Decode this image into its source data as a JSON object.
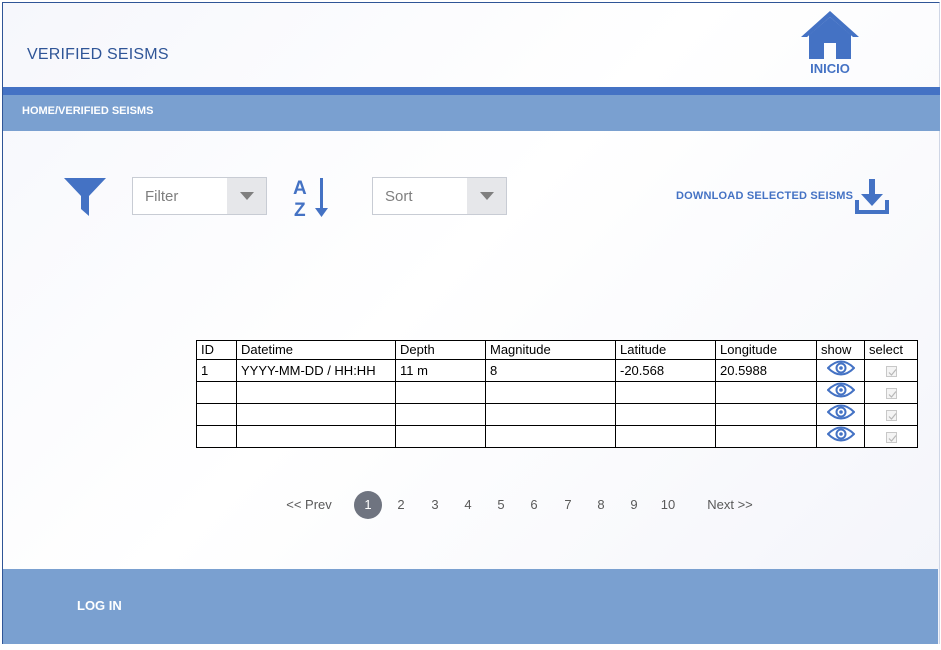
{
  "header": {
    "title": "VERIFIED SEISMS",
    "home_label": "INICIO"
  },
  "breadcrumb": "HOME/VERIFIED SEISMS",
  "toolbar": {
    "filter_value": "Filter",
    "sort_value": "Sort",
    "download_label": "DOWNLOAD SELECTED SEISMS"
  },
  "table": {
    "columns": [
      "ID",
      "Datetime",
      "Depth",
      "Magnitude",
      "Latitude",
      "Longitude",
      "show",
      "select"
    ],
    "rows": [
      [
        "1",
        "YYYY-MM-DD / HH:HH",
        "11 m",
        "8",
        "-20.568",
        "20.5988"
      ],
      [
        "",
        "",
        "",
        "",
        "",
        ""
      ],
      [
        "",
        "",
        "",
        "",
        "",
        ""
      ],
      [
        "",
        "",
        "",
        "",
        "",
        ""
      ]
    ]
  },
  "pagination": {
    "prev": "<< Prev",
    "pages": [
      "1",
      "2",
      "3",
      "4",
      "5",
      "6",
      "7",
      "8",
      "9",
      "10"
    ],
    "current": "1",
    "next": "Next >>"
  },
  "footer": {
    "login_label": "LOG IN"
  },
  "icons": {
    "home": "home-icon",
    "filter": "filter-icon",
    "sort": "sort-az-icon",
    "download": "download-icon",
    "show": "eye-icon",
    "select": "checkbox"
  },
  "colors": {
    "accent": "#4472c4",
    "bar": "#7aa0d0",
    "title": "#2f5597",
    "page_active": "#6f7480"
  }
}
